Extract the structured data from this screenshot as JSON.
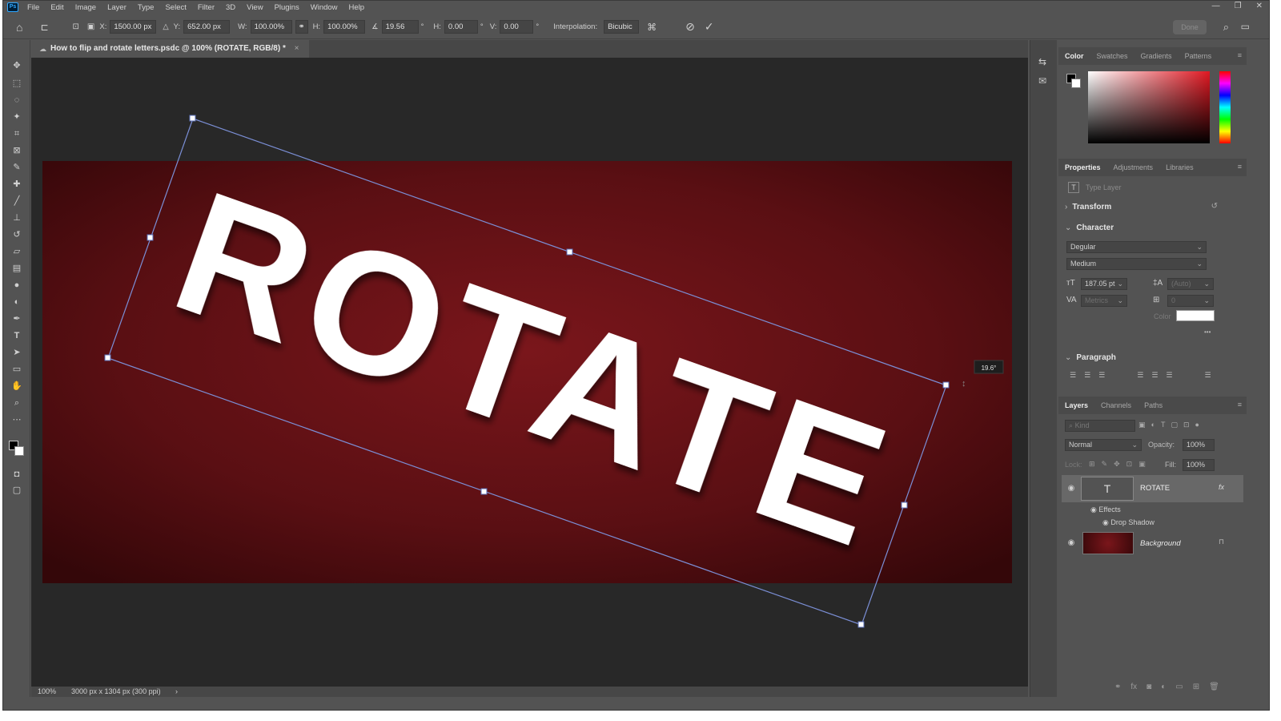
{
  "app": {
    "logo": "Ps"
  },
  "menu": [
    "File",
    "Edit",
    "Image",
    "Layer",
    "Type",
    "Select",
    "Filter",
    "3D",
    "View",
    "Plugins",
    "Window",
    "Help"
  ],
  "window_controls": {
    "minimize": "—",
    "restore": "❐",
    "close": "✕"
  },
  "options_bar": {
    "x_label": "X:",
    "x_value": "1500.00 px",
    "y_label": "Y:",
    "y_value": "652.00 px",
    "w_label": "W:",
    "w_value": "100.00%",
    "h_label": "H:",
    "h_value": "100.00%",
    "angle_value": "19.56",
    "angle_unit": "°",
    "hskew_label": "H:",
    "hskew_value": "0.00",
    "hskew_unit": "°",
    "vskew_label": "V:",
    "vskew_value": "0.00",
    "vskew_unit": "°",
    "interpolation_label": "Interpolation:",
    "interpolation_value": "Bicubic",
    "done_label": "Done"
  },
  "document": {
    "tab_title": "How to flip and rotate letters.psdc @ 100% (ROTATE, RGB/8) *",
    "canvas_text": "ROTATE",
    "rotation_tooltip": "19.6°",
    "rotation_degrees": 19.56,
    "background_color": "#6a1216",
    "text_color": "#ffffff",
    "bbox_color": "#7b8fd6"
  },
  "status_bar": {
    "zoom": "100%",
    "doc_info": "3000 px x 1304 px (300 ppi)",
    "arrow": "›"
  },
  "color_panel": {
    "tabs": [
      "Color",
      "Swatches",
      "Gradients",
      "Patterns"
    ],
    "active_tab": "Color",
    "hue_color": "#e01822"
  },
  "properties_panel": {
    "tabs": [
      "Properties",
      "Adjustments",
      "Libraries"
    ],
    "active_tab": "Properties",
    "layer_type": "Type Layer",
    "transform_title": "Transform",
    "character_title": "Character",
    "font_family": "Degular",
    "font_style": "Medium",
    "font_size": "187.05 pt",
    "leading": "(Auto)",
    "kerning": "Metrics",
    "tracking": "0",
    "color_label": "Color",
    "more": "•••",
    "paragraph_title": "Paragraph"
  },
  "layers_panel": {
    "tabs": [
      "Layers",
      "Channels",
      "Paths"
    ],
    "active_tab": "Layers",
    "search_placeholder": "Kind",
    "blend_mode": "Normal",
    "opacity_label": "Opacity:",
    "opacity_value": "100%",
    "lock_label": "Lock:",
    "fill_label": "Fill:",
    "fill_value": "100%",
    "layers": [
      {
        "name": "ROTATE",
        "type": "text",
        "fx": "fx"
      },
      {
        "name": "Background",
        "type": "image"
      }
    ],
    "effects_label": "Effects",
    "drop_shadow_label": "Drop Shadow"
  },
  "icons": {
    "home": "⌂",
    "move": "✥",
    "marquee": "⬚",
    "lasso": "◌",
    "magic": "✦",
    "crop": "⌗",
    "frame": "⊠",
    "eyedropper": "✎",
    "healing": "✚",
    "brush": "╱",
    "stamp": "⊥",
    "history": "↺",
    "eraser": "▱",
    "gradient": "▤",
    "blur": "●",
    "dodge": "◐",
    "pen": "✒",
    "type": "T",
    "path-select": "➤",
    "rectangle": "▭",
    "hand": "✋",
    "zoom": "⌕",
    "more": "⋯",
    "cancel": "⊘",
    "commit": "✓",
    "search": "⌕",
    "eye": "◉",
    "lock": "🔒"
  }
}
